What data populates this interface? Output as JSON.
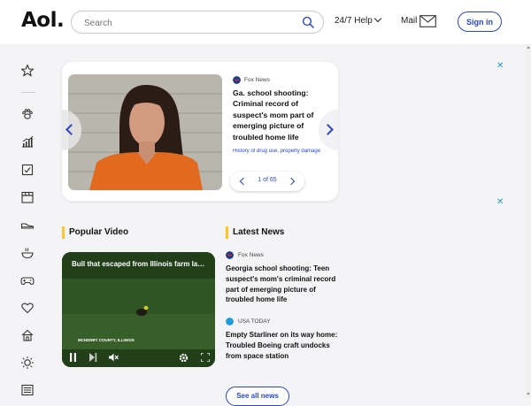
{
  "header": {
    "logo": "Aol.",
    "search_placeholder": "Search",
    "help_label": "24/7 Help",
    "mail_label": "Mail",
    "signin_label": "Sign in"
  },
  "sidebar": {
    "icons": [
      "star-icon",
      "paw-icon",
      "finance-chart-icon",
      "checklist-icon",
      "clapperboard-icon",
      "sneaker-icon",
      "food-bowl-icon",
      "gamepad-icon",
      "heart-icon",
      "house-icon",
      "sun-icon",
      "newspaper-icon"
    ]
  },
  "carousel": {
    "source": "Fox News",
    "headline": "Ga. school shooting: Criminal record of suspect's mom part of emerging picture of troubled home life",
    "related": "History of drug use, property damage",
    "pager": "1 of 65"
  },
  "popular_video": {
    "section_title": "Popular Video",
    "title": "Bull that escaped from Illinois farm lands in police custody",
    "location": "MCHENRY COUNTY, ILLINOIS"
  },
  "latest_news": {
    "section_title": "Latest News",
    "items": [
      {
        "source": "Fox News",
        "title": "Georgia school shooting: Teen suspect's mom's criminal record part of emerging picture of troubled home life"
      },
      {
        "source": "USA TODAY",
        "title": "Empty Starliner on its way home: Troubled Boeing craft undocks from space station"
      }
    ],
    "see_all_label": "See all news"
  },
  "colors": {
    "accent_blue": "#2a47cc",
    "section_bar": "#ffc52b",
    "ad_close": "#1a9ec7"
  }
}
